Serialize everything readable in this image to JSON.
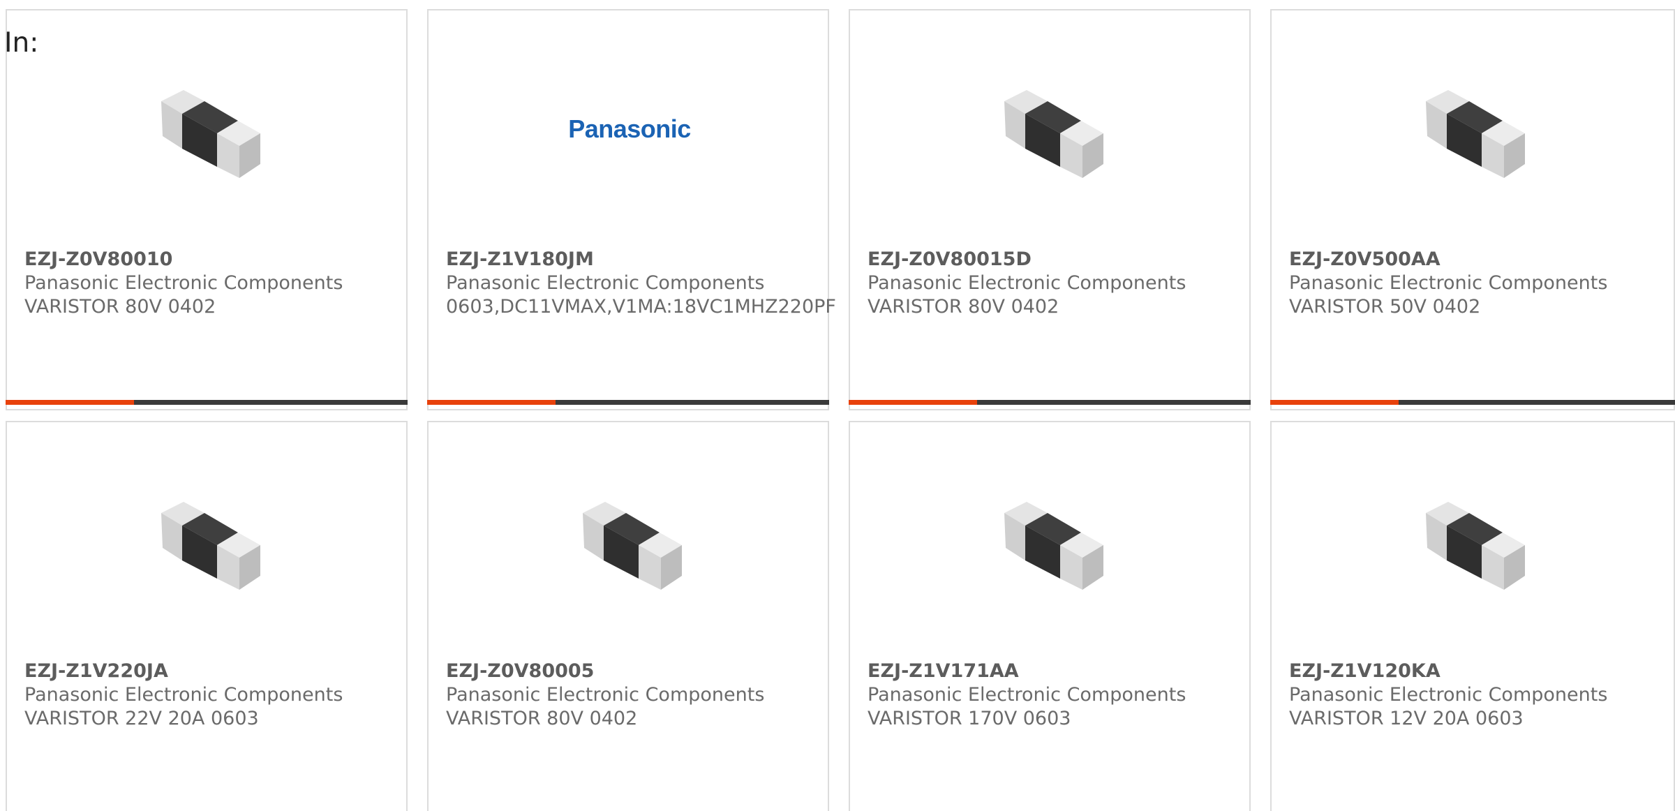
{
  "in_label": "In:",
  "colors": {
    "accent": "#e8410b",
    "bar": "#3a3a3a",
    "border": "#dcdcdc",
    "logo_blue": "#1b63b4"
  },
  "cards": [
    {
      "part": "EZJ-Z0V80010",
      "manufacturer": "Panasonic Electronic Components",
      "description": "VARISTOR 80V 0402",
      "image": "chip-component-icon"
    },
    {
      "part": "EZJ-Z1V180JM",
      "manufacturer": "Panasonic Electronic Components",
      "description": "0603,DC11VMAX,V1MA:18VC1MHZ220PF",
      "image": "panasonic-logo",
      "logo_text": "Panasonic"
    },
    {
      "part": "EZJ-Z0V80015D",
      "manufacturer": "Panasonic Electronic Components",
      "description": "VARISTOR 80V 0402",
      "image": "chip-component-icon"
    },
    {
      "part": "EZJ-Z0V500AA",
      "manufacturer": "Panasonic Electronic Components",
      "description": "VARISTOR 50V 0402",
      "image": "chip-component-icon"
    },
    {
      "part": "EZJ-Z1V220JA",
      "manufacturer": "Panasonic Electronic Components",
      "description": "VARISTOR 22V 20A 0603",
      "image": "chip-component-icon"
    },
    {
      "part": "EZJ-Z0V80005",
      "manufacturer": "Panasonic Electronic Components",
      "description": "VARISTOR 80V 0402",
      "image": "chip-component-icon"
    },
    {
      "part": "EZJ-Z1V171AA",
      "manufacturer": "Panasonic Electronic Components",
      "description": "VARISTOR 170V 0603",
      "image": "chip-component-icon"
    },
    {
      "part": "EZJ-Z1V120KA",
      "manufacturer": "Panasonic Electronic Components",
      "description": "VARISTOR 12V 20A 0603",
      "image": "chip-component-icon"
    }
  ]
}
